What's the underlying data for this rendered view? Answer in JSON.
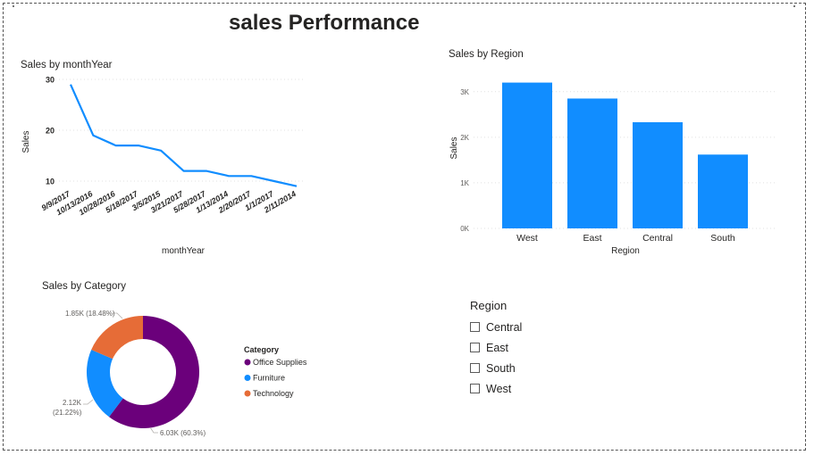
{
  "dashboard": {
    "title": "sales Performance"
  },
  "line_visual": {
    "title": "Sales by monthYear"
  },
  "bar_visual": {
    "title": "Sales by Region"
  },
  "donut_visual": {
    "title": "Sales by Category"
  },
  "slicer": {
    "title": "Region",
    "items": [
      {
        "label": "Central",
        "checked": false
      },
      {
        "label": "East",
        "checked": false
      },
      {
        "label": "South",
        "checked": false
      },
      {
        "label": "West",
        "checked": false
      }
    ]
  },
  "chart_data": [
    {
      "type": "line",
      "title": "Sales by monthYear",
      "xlabel": "monthYear",
      "ylabel": "Sales",
      "categories": [
        "9/9/2017",
        "10/13/2016",
        "10/28/2016",
        "5/18/2017",
        "3/5/2015",
        "3/21/2017",
        "5/28/2017",
        "1/13/2014",
        "2/20/2017",
        "1/1/2017",
        "2/11/2014"
      ],
      "values": [
        29,
        19,
        17,
        17,
        16,
        12,
        12,
        11,
        11,
        10,
        9
      ],
      "yticks": [
        10,
        20,
        30
      ],
      "ylim": [
        7,
        31
      ],
      "grid": true,
      "color": "#118DFF"
    },
    {
      "type": "bar",
      "title": "Sales by Region",
      "xlabel": "Region",
      "ylabel": "Sales",
      "categories": [
        "West",
        "East",
        "Central",
        "South"
      ],
      "values": [
        3200,
        2850,
        2330,
        1620
      ],
      "yticks": [
        0,
        1000,
        2000,
        3000
      ],
      "ytick_labels": [
        "0K",
        "1K",
        "2K",
        "3K"
      ],
      "ylim": [
        0,
        3300
      ],
      "grid": true,
      "color": "#118DFF"
    },
    {
      "type": "pie",
      "subtype": "donut",
      "title": "Sales by Category",
      "legend_title": "Category",
      "legend_position": "right",
      "slices": [
        {
          "name": "Office Supplies",
          "value": 6.03,
          "label": "6.03K (60.3%)",
          "color": "#6B007B"
        },
        {
          "name": "Furniture",
          "value": 2.12,
          "label_lines": [
            "2.12K",
            "(21.22%)"
          ],
          "color": "#118DFF"
        },
        {
          "name": "Technology",
          "value": 1.85,
          "label": "1.85K (18.48%)",
          "color": "#E66C37"
        }
      ]
    }
  ]
}
